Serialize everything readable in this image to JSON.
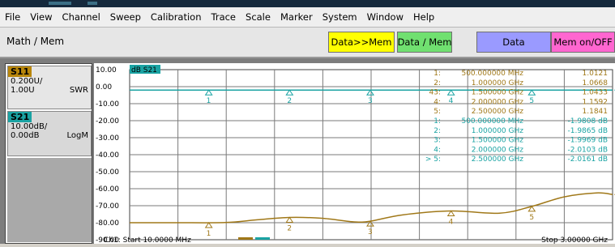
{
  "menu": [
    "File",
    "View",
    "Channel",
    "Sweep",
    "Calibration",
    "Trace",
    "Scale",
    "Marker",
    "System",
    "Window",
    "Help"
  ],
  "toolbar": {
    "title": "Math / Mem",
    "buttons": [
      {
        "label": "Data>>Mem",
        "color": "#ffff00"
      },
      {
        "label": "Data / Mem",
        "color": "#70e070"
      },
      {
        "label": "Data",
        "color": "#9a9aff"
      },
      {
        "label": "Mem on/OFF",
        "color": "#ff66d0"
      }
    ]
  },
  "traces": [
    {
      "name": "S11",
      "scale": "0.200U/",
      "ref": "1.00U",
      "format": "SWR",
      "color": "#b8860b"
    },
    {
      "name": "S21",
      "scale": "10.00dB/",
      "ref": "0.00dB",
      "format": "LogM",
      "color": "#1aa3a3"
    }
  ],
  "active_trace_label": "dB S21",
  "footer": {
    "start": "Ch1: Start 10.0000 MHz",
    "stop": "Stop 3.00000 GHz"
  },
  "markers_s11": [
    {
      "id": "1:",
      "freq": "500.000000 MHz",
      "value": "1.0121"
    },
    {
      "id": "2:",
      "freq": "1.000000 GHz",
      "value": "1.0668"
    },
    {
      "id": "43:",
      "freq": "1.500000 GHz",
      "value": "1.0433"
    },
    {
      "id": "4:",
      "freq": "2.000000 GHz",
      "value": "1.1592"
    },
    {
      "id": "5:",
      "freq": "2.500000 GHz",
      "value": "1.1841"
    }
  ],
  "markers_s21": [
    {
      "id": "1:",
      "freq": "500.000000 MHz",
      "value": "-1.9808 dB"
    },
    {
      "id": "2:",
      "freq": "1.000000 GHz",
      "value": "-1.9865 dB"
    },
    {
      "id": "3:",
      "freq": "1.500000 GHz",
      "value": "-1.9969 dB"
    },
    {
      "id": "4:",
      "freq": "2.000000 GHz",
      "value": "-2.0103 dB"
    },
    {
      "id": "> 5:",
      "freq": "2.500000 GHz",
      "value": "-2.0161 dB"
    }
  ],
  "chart_data": {
    "type": "line",
    "ylim": [
      -90,
      10
    ],
    "xlim_mhz": [
      10,
      3000
    ],
    "y_tick_labels": [
      "10.00",
      "0.00",
      "-10.00",
      "-20.00",
      "-30.00",
      "-40.00",
      "-50.00",
      "-60.00",
      "-70.00",
      "-80.00",
      "-90.00"
    ],
    "grid": true,
    "series": [
      {
        "name": "S21",
        "color": "#1aa3a3",
        "x": [
          10,
          3000
        ],
        "y": [
          -2.0,
          -2.0
        ]
      },
      {
        "name": "S11",
        "color": "#a07818",
        "x": [
          10,
          300,
          600,
          800,
          1000,
          1200,
          1400,
          1500,
          1700,
          2000,
          2300,
          2500,
          2700,
          2900,
          3000
        ],
        "y": [
          -80.0,
          -80.0,
          -79.9,
          -78.3,
          -76.9,
          -77.4,
          -79.5,
          -79.1,
          -75.4,
          -73.1,
          -74.4,
          -70.4,
          -64.8,
          -62.5,
          -63.4
        ]
      }
    ],
    "markers_s11_plot": [
      {
        "label": "1",
        "x": 500,
        "y": -80.0
      },
      {
        "label": "2",
        "x": 1000,
        "y": -76.9
      },
      {
        "label": "3",
        "x": 1500,
        "y": -79.1
      },
      {
        "label": "4",
        "x": 2000,
        "y": -73.1
      },
      {
        "label": "5",
        "x": 2500,
        "y": -70.4
      }
    ],
    "markers_s21_plot": [
      {
        "label": "1",
        "x": 500,
        "y": -2.0
      },
      {
        "label": "2",
        "x": 1000,
        "y": -2.0
      },
      {
        "label": "3",
        "x": 1500,
        "y": -2.0
      },
      {
        "label": "4",
        "x": 2000,
        "y": -2.0
      },
      {
        "label": "5",
        "x": 2500,
        "y": -2.0
      }
    ]
  }
}
